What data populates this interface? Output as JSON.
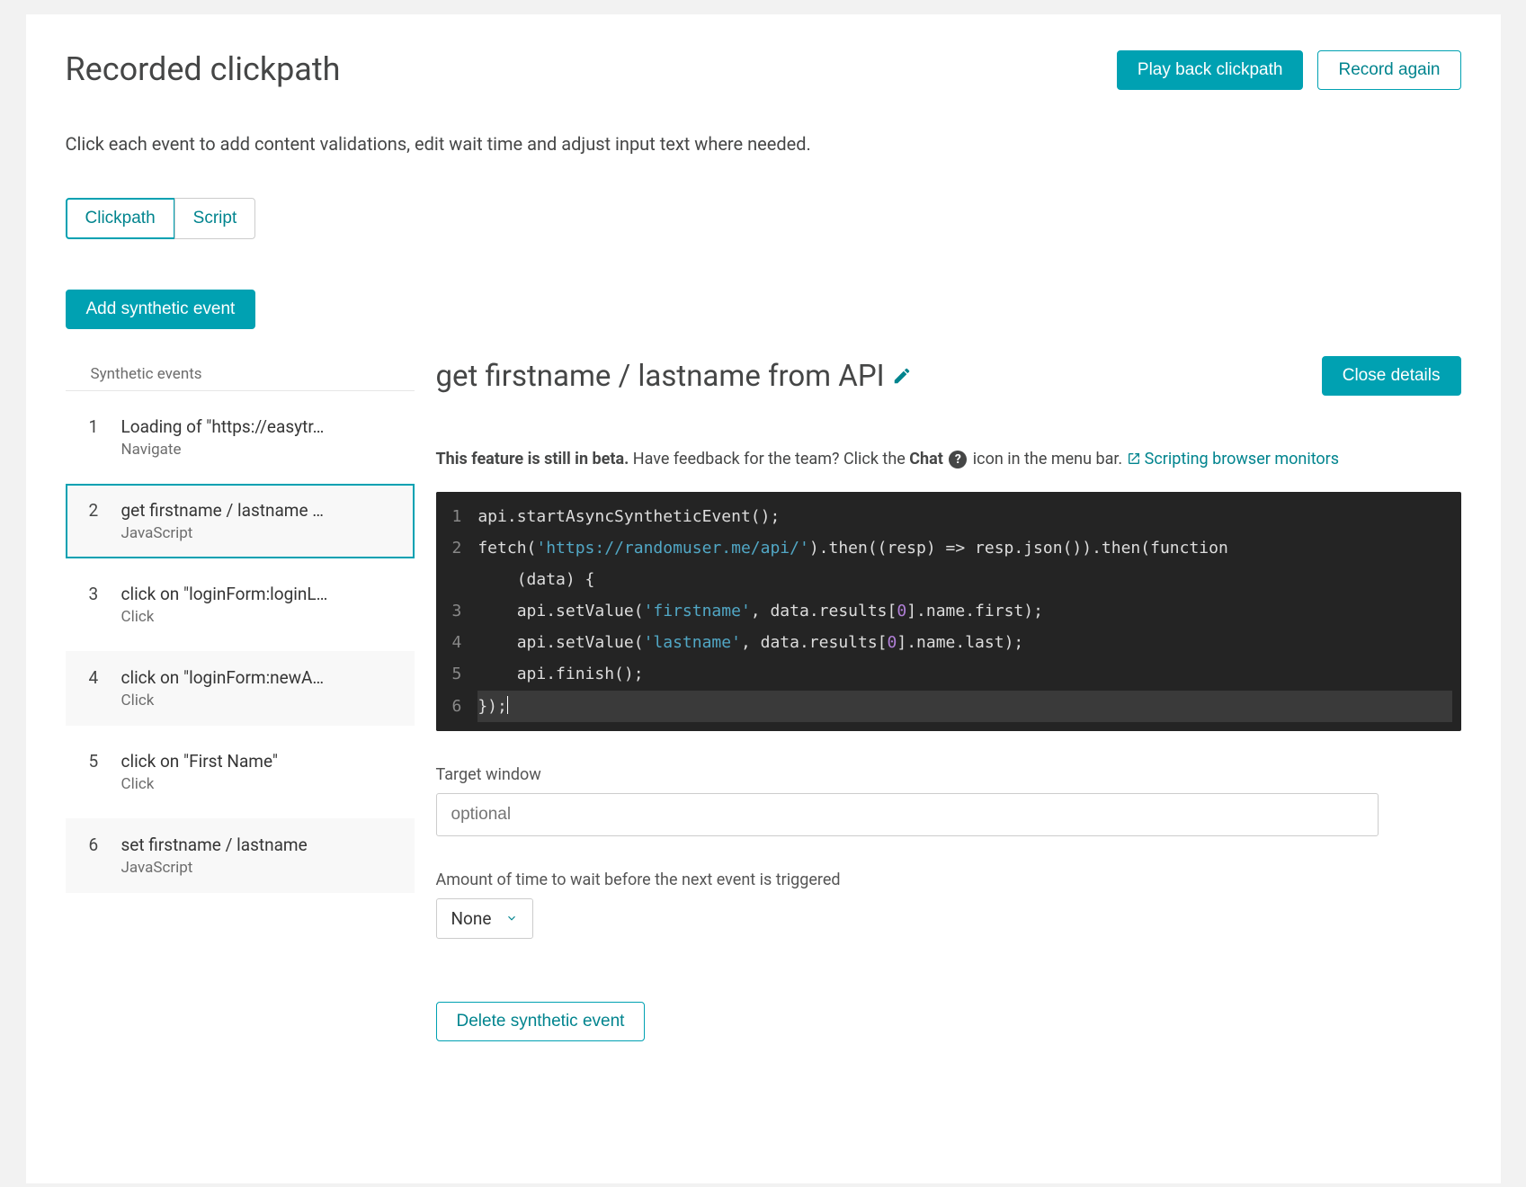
{
  "header": {
    "title": "Recorded clickpath",
    "playback_label": "Play back clickpath",
    "record_label": "Record again"
  },
  "subtitle": "Click each event to add content validations, edit wait time and adjust input text where needed.",
  "tabs": {
    "clickpath": "Clickpath",
    "script": "Script"
  },
  "add_event_label": "Add synthetic event",
  "sidebar": {
    "header": "Synthetic events",
    "items": [
      {
        "num": "1",
        "title": "Loading of \"https://easytr…",
        "type": "Navigate",
        "alt": false,
        "active": false
      },
      {
        "num": "2",
        "title": "get firstname / lastname …",
        "type": "JavaScript",
        "alt": true,
        "active": true
      },
      {
        "num": "3",
        "title": "click on \"loginForm:loginL…",
        "type": "Click",
        "alt": false,
        "active": false
      },
      {
        "num": "4",
        "title": "click on \"loginForm:newA…",
        "type": "Click",
        "alt": true,
        "active": false
      },
      {
        "num": "5",
        "title": "click on \"First Name\"",
        "type": "Click",
        "alt": false,
        "active": false
      },
      {
        "num": "6",
        "title": "set firstname / lastname",
        "type": "JavaScript",
        "alt": true,
        "active": false
      }
    ]
  },
  "details": {
    "title": "get firstname / lastname from API",
    "close_label": "Close details",
    "beta_bold": "This feature is still in beta.",
    "beta_text1": " Have feedback for the team? Click the ",
    "beta_chat": "Chat",
    "beta_text2": " icon in the menu bar. ",
    "link_label": "Scripting browser monitors",
    "target_label": "Target window",
    "target_placeholder": "optional",
    "wait_label": "Amount of time to wait before the next event is triggered",
    "wait_value": "None",
    "delete_label": "Delete synthetic event",
    "code": {
      "l1": "api.startAsyncSyntheticEvent();",
      "l2a": "fetch(",
      "l2s": "'https://randomuser.me/api/'",
      "l2b": ").then((resp) => resp.json()).then(function",
      "l2c": "    (data) {",
      "l3a": "    api.setValue(",
      "l3s": "'firstname'",
      "l3b": ", data.results[",
      "l3n": "0",
      "l3c": "].name.first);",
      "l4a": "    api.setValue(",
      "l4s": "'lastname'",
      "l4b": ", data.results[",
      "l4n": "0",
      "l4c": "].name.last);",
      "l5": "    api.finish();",
      "l6": "});"
    }
  }
}
